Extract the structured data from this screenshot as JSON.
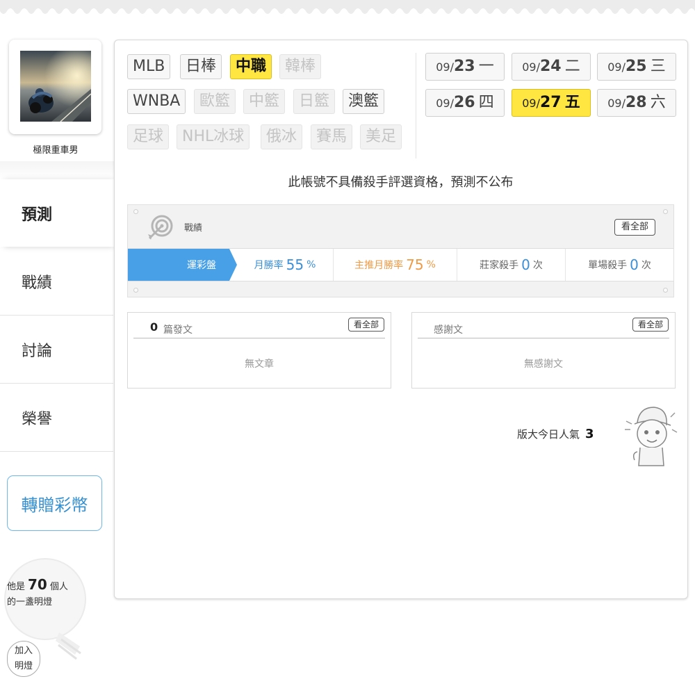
{
  "user": {
    "name": "極限重車男"
  },
  "nav": {
    "prediction": "預測",
    "record": "戰績",
    "discussion": "討論",
    "honor": "榮譽"
  },
  "gift_button": "轉贈彩幣",
  "lamp": {
    "line1_prefix": "他是",
    "count": "70",
    "line1_suffix": "個人",
    "line2": "的一盞明燈",
    "join_line1": "加入",
    "join_line2": "明燈"
  },
  "leagues": [
    {
      "label": "MLB",
      "state": "normal"
    },
    {
      "label": "日棒",
      "state": "normal"
    },
    {
      "label": "中職",
      "state": "active"
    },
    {
      "label": "韓棒",
      "state": "disabled"
    },
    {
      "label": "WNBA",
      "state": "normal"
    },
    {
      "label": "歐籃",
      "state": "disabled"
    },
    {
      "label": "中籃",
      "state": "disabled"
    },
    {
      "label": "日籃",
      "state": "disabled"
    },
    {
      "label": "澳籃",
      "state": "normal"
    },
    {
      "label": "足球",
      "state": "disabled"
    },
    {
      "label": "NHL冰球",
      "state": "disabled"
    },
    {
      "label": "俄冰",
      "state": "disabled"
    },
    {
      "label": "賽馬",
      "state": "disabled"
    },
    {
      "label": "美足",
      "state": "disabled"
    }
  ],
  "dates": [
    {
      "month": "09/",
      "day": "23",
      "weekday": "一",
      "active": false
    },
    {
      "month": "09/",
      "day": "24",
      "weekday": "二",
      "active": false
    },
    {
      "month": "09/",
      "day": "25",
      "weekday": "三",
      "active": false
    },
    {
      "month": "09/",
      "day": "26",
      "weekday": "四",
      "active": false
    },
    {
      "month": "09/",
      "day": "27",
      "weekday": "五",
      "active": true
    },
    {
      "month": "09/",
      "day": "28",
      "weekday": "六",
      "active": false
    }
  ],
  "notice": "此帳號不具備殺手評選資格，預測不公布",
  "record": {
    "title": "戰績",
    "see_all": "看全部",
    "tab": "運彩盤",
    "monthly_win_label": "月勝率",
    "monthly_win_value": "55",
    "main_win_label": "主推月勝率",
    "main_win_value": "75",
    "percent": "%",
    "banker_label": "莊家殺手",
    "banker_value": "0",
    "single_label": "單場殺手",
    "single_value": "0",
    "times_unit": "次"
  },
  "posts": {
    "count": "0",
    "count_label": "篇發文",
    "see_all": "看全部",
    "empty": "無文章"
  },
  "thanks": {
    "label": "感謝文",
    "see_all": "看全部",
    "empty": "無感謝文"
  },
  "popularity": {
    "label": "版大今日人氣",
    "value": "3"
  },
  "colors": {
    "accent_blue": "#48a0e6",
    "active_yellow": "#ffe641",
    "orange": "#f0a050"
  }
}
